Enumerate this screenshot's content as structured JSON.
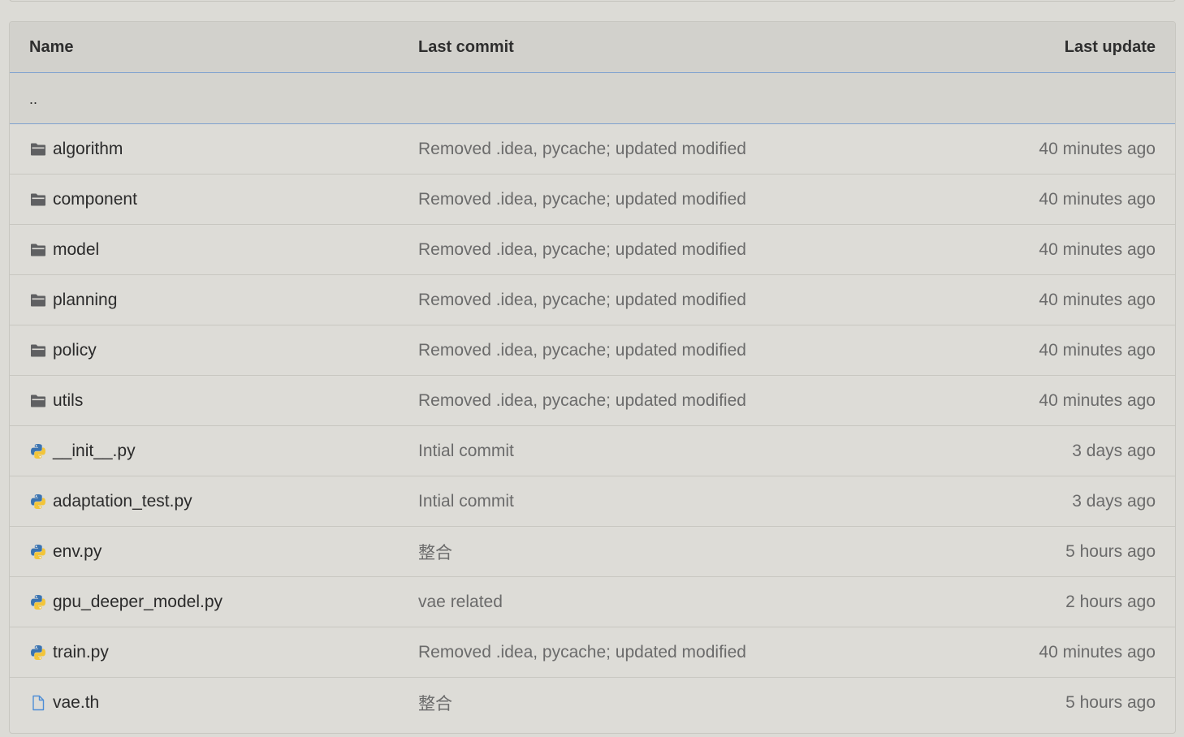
{
  "columns": {
    "name": "Name",
    "last_commit": "Last commit",
    "last_update": "Last update"
  },
  "parent_link": "..",
  "rows": [
    {
      "type": "folder",
      "icon": "folder-icon",
      "name": "algorithm",
      "commit": "Removed .idea, pycache; updated modified",
      "updated": "40 minutes ago"
    },
    {
      "type": "folder",
      "icon": "folder-icon",
      "name": "component",
      "commit": "Removed .idea, pycache; updated modified",
      "updated": "40 minutes ago"
    },
    {
      "type": "folder",
      "icon": "folder-icon",
      "name": "model",
      "commit": "Removed .idea, pycache; updated modified",
      "updated": "40 minutes ago"
    },
    {
      "type": "folder",
      "icon": "folder-icon",
      "name": "planning",
      "commit": "Removed .idea, pycache; updated modified",
      "updated": "40 minutes ago"
    },
    {
      "type": "folder",
      "icon": "folder-icon",
      "name": "policy",
      "commit": "Removed .idea, pycache; updated modified",
      "updated": "40 minutes ago"
    },
    {
      "type": "folder",
      "icon": "folder-icon",
      "name": "utils",
      "commit": "Removed .idea, pycache; updated modified",
      "updated": "40 minutes ago"
    },
    {
      "type": "python",
      "icon": "python-file-icon",
      "name": "__init__.py",
      "commit": "Intial commit",
      "updated": "3 days ago"
    },
    {
      "type": "python",
      "icon": "python-file-icon",
      "name": "adaptation_test.py",
      "commit": "Intial commit",
      "updated": "3 days ago"
    },
    {
      "type": "python",
      "icon": "python-file-icon",
      "name": "env.py",
      "commit": "整合",
      "updated": "5 hours ago"
    },
    {
      "type": "python",
      "icon": "python-file-icon",
      "name": "gpu_deeper_model.py",
      "commit": "vae related",
      "updated": "2 hours ago"
    },
    {
      "type": "python",
      "icon": "python-file-icon",
      "name": "train.py",
      "commit": "Removed .idea, pycache; updated modified",
      "updated": "40 minutes ago"
    },
    {
      "type": "file",
      "icon": "file-icon",
      "name": "vae.th",
      "commit": "整合",
      "updated": "5 hours ago"
    }
  ],
  "colors": {
    "background": "#dcdbd6",
    "header_bg": "#d2d1cc",
    "divider_accent": "#7fa2cf",
    "folder_icon": "#5f6062",
    "python_blue": "#3a73b0",
    "python_yellow": "#f2c53a",
    "file_icon": "#4f8ed6"
  }
}
